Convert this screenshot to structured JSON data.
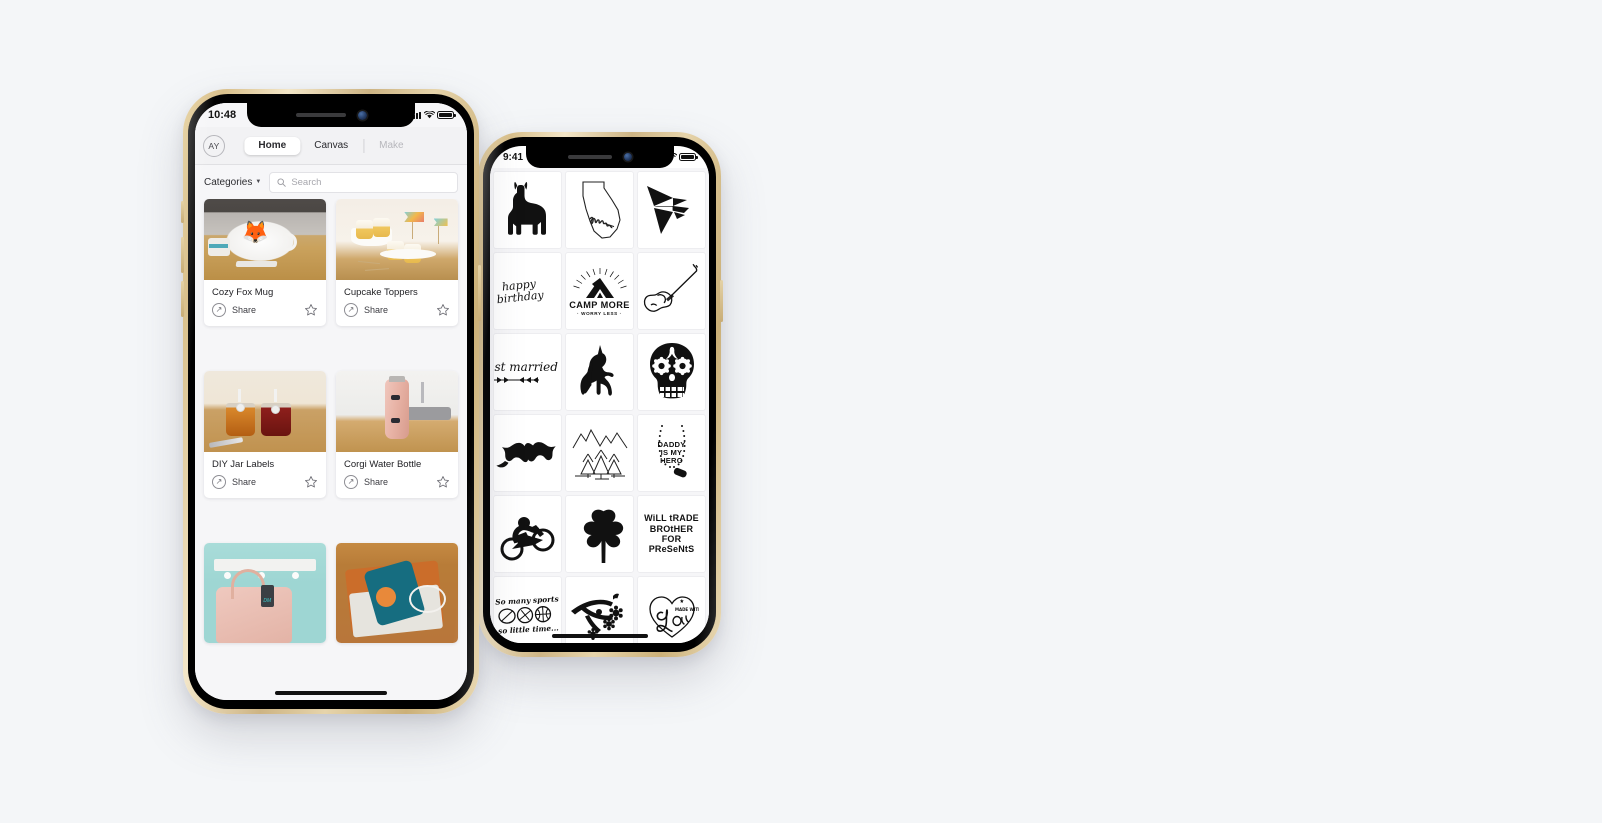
{
  "background_color": "#f4f6f8",
  "phones": {
    "right": {
      "name": "design-library-phone",
      "status": {
        "time": "9:41",
        "signal_icon": "cellular-bars-icon",
        "wifi_icon": "wifi-icon",
        "battery_icon": "battery-icon"
      },
      "grid": {
        "columns": 3,
        "rows": 5,
        "items": [
          {
            "id": "llama",
            "label": "Llama silhouette",
            "style": "solid"
          },
          {
            "id": "california-home",
            "label": "home",
            "style": "outline"
          },
          {
            "id": "origami-bird",
            "label": "Geometric bird",
            "style": "solid"
          },
          {
            "id": "happy-birthday",
            "label": "happy birthday",
            "style": "script"
          },
          {
            "id": "camp-more",
            "label": "CAMP MORE",
            "sublabel": "· WORRY LESS ·",
            "style": "badge"
          },
          {
            "id": "electric-guitar",
            "label": "Electric guitar",
            "style": "outline"
          },
          {
            "id": "just-married",
            "label": "just married",
            "style": "script"
          },
          {
            "id": "unicorn",
            "label": "Rearing unicorn",
            "style": "solid"
          },
          {
            "id": "sugar-skull",
            "label": "Sugar skull",
            "style": "solid"
          },
          {
            "id": "bat",
            "label": "Bat",
            "style": "solid"
          },
          {
            "id": "mountain-pines",
            "label": "Mountains and pine trees",
            "style": "outline"
          },
          {
            "id": "daddy-is-my-hero",
            "label": "DADDY IS MY HERO",
            "lines": [
              "DADDY",
              "IS MY",
              "HERO"
            ],
            "style": "text"
          },
          {
            "id": "bmx-rider",
            "label": "BMX rider",
            "style": "solid"
          },
          {
            "id": "shamrock",
            "label": "Four leaf clover",
            "style": "solid"
          },
          {
            "id": "will-trade-brother",
            "label": "WILL TRADE BROTHER FOR PRESENTS",
            "lines": [
              "WiLL tRADE",
              "BROtHER",
              "FOR",
              "PReSeNtS"
            ],
            "style": "text"
          },
          {
            "id": "so-many-sports",
            "label": "So many sports so little time...",
            "lines": [
              "So many sports",
              "so little time..."
            ],
            "style": "script"
          },
          {
            "id": "cherry-branch",
            "label": "Flowering branch",
            "style": "solid"
          },
          {
            "id": "made-with-love",
            "label": "made with love",
            "style": "outline"
          }
        ]
      },
      "home_indicator": "home-indicator"
    },
    "left": {
      "name": "projects-phone",
      "status": {
        "time": "10:48",
        "signal_icon": "cellular-bars-icon",
        "wifi_icon": "wifi-icon",
        "battery_icon": "battery-icon"
      },
      "topbar": {
        "avatar_initials": "AY",
        "tabs": [
          {
            "label": "Home",
            "state": "active"
          },
          {
            "label": "Canvas",
            "state": "default"
          },
          {
            "label": "Make",
            "state": "disabled"
          }
        ]
      },
      "filterbar": {
        "categories_label": "Categories",
        "categories_caret_icon": "chevron-down-icon",
        "search_icon": "search-icon",
        "search_placeholder": "Search",
        "search_value": ""
      },
      "cards": [
        {
          "title": "Cozy Fox Mug",
          "share_label": "Share",
          "share_icon": "share-arrow-icon",
          "favorite_icon": "star-outline-icon",
          "photo": "ph-mug"
        },
        {
          "title": "Cupcake Toppers",
          "share_label": "Share",
          "share_icon": "share-arrow-icon",
          "favorite_icon": "star-outline-icon",
          "photo": "ph-cake"
        },
        {
          "title": "DIY Jar Labels",
          "share_label": "Share",
          "share_icon": "share-arrow-icon",
          "favorite_icon": "star-outline-icon",
          "photo": "ph-jar"
        },
        {
          "title": "Corgi Water Bottle",
          "share_label": "Share",
          "share_icon": "share-arrow-icon",
          "favorite_icon": "star-outline-icon",
          "photo": "ph-bottle"
        },
        {
          "title": "",
          "share_label": "",
          "share_icon": "",
          "favorite_icon": "",
          "photo": "ph-bag"
        },
        {
          "title": "",
          "share_label": "",
          "share_icon": "",
          "favorite_icon": "",
          "photo": "ph-phonecase"
        }
      ]
    }
  }
}
